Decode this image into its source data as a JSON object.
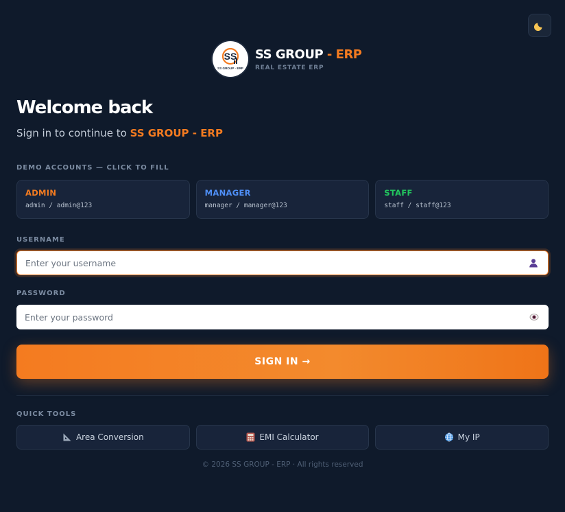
{
  "theme_toggle": {
    "icon": "moon-icon"
  },
  "brand": {
    "logo_text": "SS",
    "logo_tagline": "SS GROUP · ERP",
    "name_main": "SS GROUP",
    "name_accent": " - ERP",
    "subtitle": "REAL ESTATE ERP"
  },
  "heading": {
    "title": "Welcome back",
    "subtitle_prefix": "Sign in to continue to ",
    "subtitle_accent": "SS GROUP - ERP"
  },
  "demo": {
    "label": "DEMO ACCOUNTS — CLICK TO FILL",
    "accounts": [
      {
        "role": "ADMIN",
        "credentials": "admin / admin@123",
        "color": "#f47b20"
      },
      {
        "role": "MANAGER",
        "credentials": "manager / manager@123",
        "color": "#4f8ff7"
      },
      {
        "role": "STAFF",
        "credentials": "staff / staff@123",
        "color": "#22c55e"
      }
    ]
  },
  "username": {
    "label": "USERNAME",
    "value": "",
    "placeholder": "Enter your username",
    "icon": "user-icon"
  },
  "password": {
    "label": "PASSWORD",
    "value": "",
    "placeholder": "Enter your password",
    "icon": "eye-icon"
  },
  "signin": {
    "label": "SIGN IN →"
  },
  "tools": {
    "label": "QUICK TOOLS",
    "items": [
      {
        "label": "Area Conversion",
        "icon": "ruler-triangle-icon"
      },
      {
        "label": "EMI Calculator",
        "icon": "calculator-icon"
      },
      {
        "label": "My IP",
        "icon": "globe-icon"
      }
    ]
  },
  "footer": {
    "text": "© 2026 SS GROUP - ERP · All rights reserved"
  },
  "colors": {
    "background": "#0f1a2b",
    "accent": "#f47b20",
    "card": "#18243a"
  }
}
